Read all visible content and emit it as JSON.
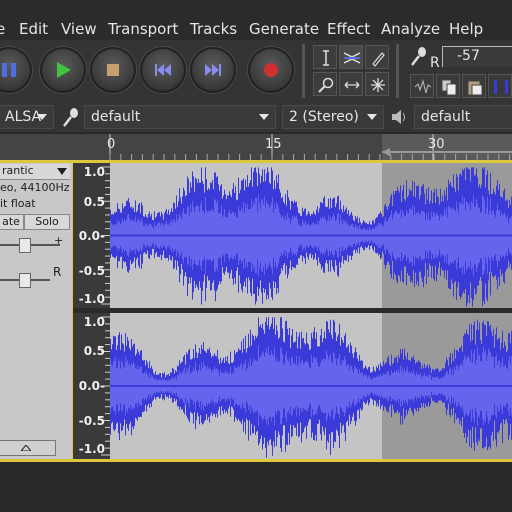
{
  "menu": [
    "Edit",
    "View",
    "Transport",
    "Tracks",
    "Generate",
    "Effect",
    "Analyze",
    "Help"
  ],
  "meter": {
    "channel_label": "R",
    "level_text": "-57"
  },
  "devices": {
    "host": "ALSA",
    "recording_device": "default",
    "channels": "2 (Stereo) R",
    "playback_device": "default"
  },
  "ruler": {
    "ticks": [
      "0",
      "15",
      "30"
    ]
  },
  "track": {
    "name": "rantic",
    "info_rate": "eo, 44100Hz",
    "info_format": "it float",
    "mute_label": "ate",
    "solo_label": "Solo",
    "gain_plus": "+",
    "pan_right": "R"
  },
  "vruler_labels": [
    "1.0",
    "0.5",
    "0.0-",
    "-0.5",
    "-1.0"
  ],
  "colors": {
    "waveform": "#3a3ad8",
    "waveform_rms": "#6464ec",
    "background": "#c4c4c4",
    "selection": "#9a9a9a",
    "border": "#dcc83c"
  }
}
